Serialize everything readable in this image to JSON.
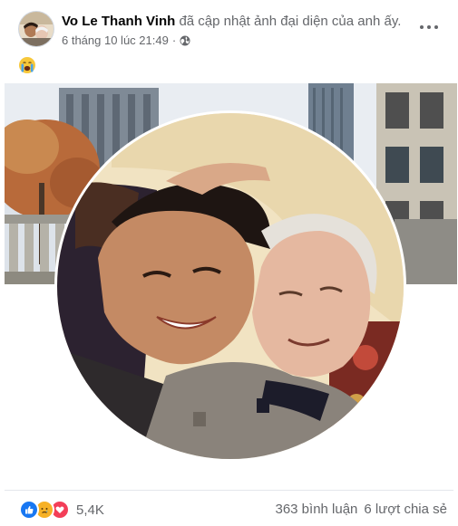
{
  "post": {
    "author_name": "Vo Le Thanh Vinh",
    "action_text": "đã cập nhật ảnh đại diện của anh ấy.",
    "timestamp": "6 tháng 10 lúc 21:49",
    "separator": "·",
    "privacy_icon": "globe-icon",
    "status_emoji": "crying-face-emoji"
  },
  "footer": {
    "reaction_icons": [
      "like-icon",
      "sad-icon",
      "love-icon"
    ],
    "reaction_count": "5,4K",
    "comments": "363 bình luận",
    "shares": "6 lượt chia sẻ"
  },
  "colors": {
    "like": "#1877f2",
    "sad": "#f7b125",
    "love": "#f33e58",
    "secondary_text": "#65676b"
  }
}
